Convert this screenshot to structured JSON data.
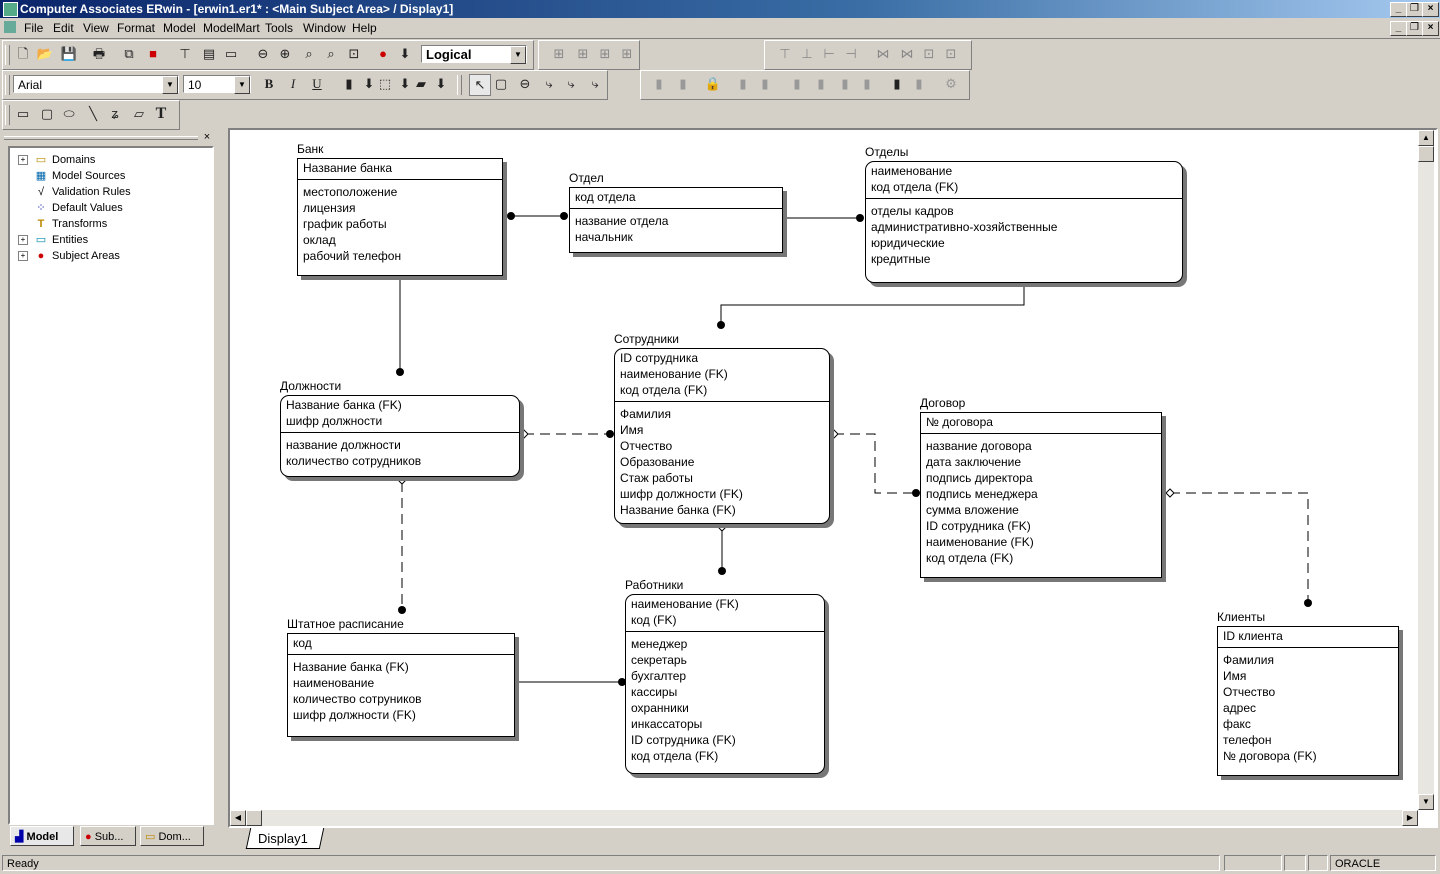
{
  "window": {
    "title": "Computer Associates ERwin - [erwin1.er1* : <Main Subject Area> / Display1]"
  },
  "menu": [
    "File",
    "Edit",
    "View",
    "Format",
    "Model",
    "ModelMart",
    "Tools",
    "Window",
    "Help"
  ],
  "toolbar": {
    "view_mode": "Logical",
    "font_name": "Arial",
    "font_size": "10",
    "bold": "B",
    "italic": "I",
    "underline": "U",
    "text_tool": "T"
  },
  "tree": {
    "items": [
      {
        "label": "Domains",
        "expand": "+",
        "icon": "▭"
      },
      {
        "label": "Model Sources",
        "expand": "",
        "icon": "▦"
      },
      {
        "label": "Validation Rules",
        "expand": "",
        "icon": "√"
      },
      {
        "label": "Default Values",
        "expand": "",
        "icon": "⁘"
      },
      {
        "label": "Transforms",
        "expand": "",
        "icon": "T"
      },
      {
        "label": "Entities",
        "expand": "+",
        "icon": "▭"
      },
      {
        "label": "Subject Areas",
        "expand": "+",
        "icon": "●"
      }
    ],
    "tabs": [
      "Model",
      "Sub...",
      "Dom..."
    ]
  },
  "entities": {
    "bank": {
      "name": "Банк",
      "pk": [
        "Название банка"
      ],
      "attrs": [
        "местоположение",
        "лицензия",
        "график работы",
        "оклад",
        "рабочий телефон"
      ]
    },
    "otdel": {
      "name": "Отдел",
      "pk": [
        "код отдела"
      ],
      "attrs": [
        "название отдела",
        "начальник"
      ]
    },
    "otdely": {
      "name": "Отделы",
      "pk": [
        "наименование",
        "код отдела (FK)"
      ],
      "attrs": [
        "отделы кадров",
        "административно-хозяйственные",
        "юридические",
        "кредитные"
      ]
    },
    "sotrudniki": {
      "name": "Сотрудники",
      "pk": [
        "ID сотрудника",
        "наименование (FK)",
        "код отдела (FK)"
      ],
      "attrs": [
        "Фамилия",
        "Имя",
        "Отчество",
        "Образование",
        "Стаж работы",
        "шифр должности (FK)",
        "Название банка (FK)"
      ]
    },
    "dolzhnosti": {
      "name": "Должности",
      "pk": [
        "Название банка (FK)",
        "шифр должности"
      ],
      "attrs": [
        "название должности",
        "количество сотрудников"
      ]
    },
    "dogovor": {
      "name": "Договор",
      "pk": [
        "№ договора"
      ],
      "attrs": [
        "название договора",
        "дата заключение",
        "подпись директора",
        "подпись менеджера",
        "сумма вложение",
        "ID сотрудника (FK)",
        "наименование (FK)",
        "код отдела (FK)"
      ]
    },
    "shtat": {
      "name": "Штатное расписание",
      "pk": [
        "код"
      ],
      "attrs": [
        "Название банка (FK)",
        "наименование",
        "количество сотруников",
        "шифр должности (FK)"
      ]
    },
    "rabotniki": {
      "name": "Работники",
      "pk": [
        "наименование (FK)",
        "код (FK)"
      ],
      "attrs": [
        "менеджер",
        "секретарь",
        "бухгалтер",
        "кассиры",
        "охранники",
        "инкассаторы",
        "ID сотрудника (FK)",
        "код отдела (FK)"
      ]
    },
    "klienty": {
      "name": "Клиенты",
      "pk": [
        "ID клиента"
      ],
      "attrs": [
        "Фамилия",
        "Имя",
        "Отчество",
        "адрес",
        "факс",
        "телефон",
        "№ договора (FK)"
      ]
    }
  },
  "canvas_tab": "Display1",
  "status": {
    "text": "Ready",
    "db": "ORACLE"
  }
}
